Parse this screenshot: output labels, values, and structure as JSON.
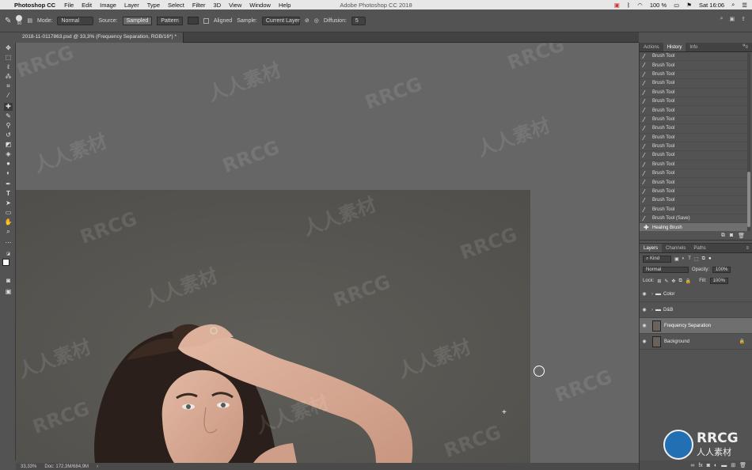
{
  "menubar": {
    "app": "Photoshop CC",
    "items": [
      "File",
      "Edit",
      "Image",
      "Layer",
      "Type",
      "Select",
      "Filter",
      "3D",
      "View",
      "Window",
      "Help"
    ],
    "window_title": "Adobe Photoshop CC 2018",
    "status_right": {
      "battery": "100 %",
      "clock": "Sat 16:06"
    }
  },
  "options": {
    "brush_size": "50",
    "mode_label": "Mode:",
    "mode_value": "Normal",
    "source_label": "Source:",
    "source_sampled": "Sampled",
    "source_pattern": "Pattern",
    "aligned_label": "Aligned",
    "sample_label": "Sample:",
    "sample_value": "Current Layer",
    "diffusion_label": "Diffusion:",
    "diffusion_value": "5"
  },
  "document": {
    "tab_title": "2018-11-0117863.psd @ 33,3% (Frequency Separation, RGB/16*) *"
  },
  "statusbar": {
    "zoom": "33,33%",
    "doc_size": "Doc: 172,3M/684,9M"
  },
  "history_panel": {
    "tabs": [
      "Actions",
      "History",
      "Info"
    ],
    "active_tab": "History",
    "items": [
      "Brush Tool",
      "Brush Tool",
      "Brush Tool",
      "Brush Tool",
      "Brush Tool",
      "Brush Tool",
      "Brush Tool",
      "Brush Tool",
      "Brush Tool",
      "Brush Tool",
      "Brush Tool",
      "Brush Tool",
      "Brush Tool",
      "Brush Tool",
      "Brush Tool",
      "Brush Tool",
      "Brush Tool",
      "Brush Tool",
      "Brush Tool (Save)",
      "Healing Brush"
    ],
    "active_item": "Healing Brush"
  },
  "layers_panel": {
    "tabs": [
      "Layers",
      "Channels",
      "Paths"
    ],
    "active_tab": "Layers",
    "kind_label": "Kind",
    "blend_mode": "Normal",
    "opacity_label": "Opacity:",
    "opacity_value": "100%",
    "lock_label": "Lock:",
    "fill_label": "Fill:",
    "fill_value": "100%",
    "layers": [
      {
        "name": "Color",
        "type": "group"
      },
      {
        "name": "D&B",
        "type": "group"
      },
      {
        "name": "Frequency Separation",
        "type": "layer",
        "active": true
      },
      {
        "name": "Background",
        "type": "layer"
      }
    ]
  },
  "watermarks": {
    "text_a": "RRCG",
    "text_b": "人人素材"
  },
  "brand": {
    "logo_text": "RRCG",
    "logo_sub": "人人素材"
  }
}
